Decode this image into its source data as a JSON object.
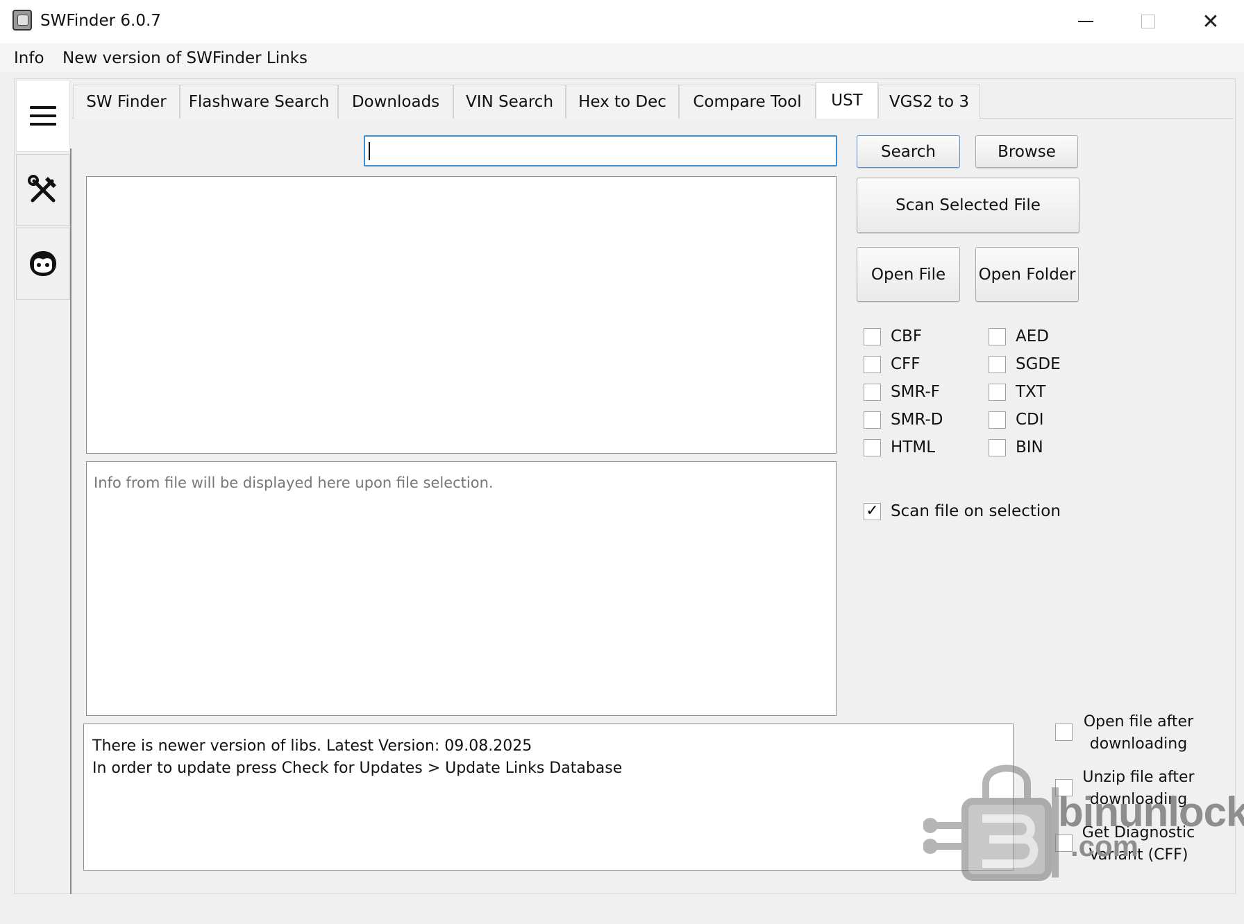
{
  "window": {
    "title": "SWFinder 6.0.7"
  },
  "menu": {
    "items": [
      "Info",
      "New version of SWFinder Links"
    ]
  },
  "sidebar": {
    "buttons": [
      {
        "icon": "hamburger-menu-icon"
      },
      {
        "icon": "tools-icon"
      },
      {
        "icon": "face-icon"
      }
    ]
  },
  "tabs": [
    {
      "label": "SW Finder",
      "active": false
    },
    {
      "label": "Flashware Search",
      "active": false
    },
    {
      "label": "Downloads",
      "active": false
    },
    {
      "label": "VIN Search",
      "active": false
    },
    {
      "label": "Hex to Dec",
      "active": false
    },
    {
      "label": "Compare Tool",
      "active": false
    },
    {
      "label": "UST",
      "active": true
    },
    {
      "label": "VGS2 to 3",
      "active": false
    }
  ],
  "search": {
    "value": ""
  },
  "buttons": {
    "search": "Search",
    "browse": "Browse",
    "scan_selected": "Scan Selected File",
    "open_file": "Open File",
    "open_folder": "Open Folder"
  },
  "filters": {
    "col1": [
      {
        "label": "CBF",
        "checked": false
      },
      {
        "label": "CFF",
        "checked": false
      },
      {
        "label": "SMR-F",
        "checked": false
      },
      {
        "label": "SMR-D",
        "checked": false
      },
      {
        "label": "HTML",
        "checked": false
      }
    ],
    "col2": [
      {
        "label": "AED",
        "checked": false
      },
      {
        "label": "SGDE",
        "checked": false
      },
      {
        "label": "TXT",
        "checked": false
      },
      {
        "label": "CDI",
        "checked": false
      },
      {
        "label": "BIN",
        "checked": false
      }
    ]
  },
  "scan_on_selection": {
    "label": "Scan file on selection",
    "checked": true
  },
  "info_pane": {
    "placeholder": "Info from file will be displayed here upon file selection."
  },
  "log": {
    "line1": "There is newer version of libs. Latest Version: 09.08.2025",
    "line2": "In order to update press Check for Updates > Update Links Database"
  },
  "options": {
    "open_after_download": {
      "line1": "Open file after",
      "line2": "downloading",
      "checked": false
    },
    "unzip_after_download": {
      "line1": "Unzip file after",
      "line2": "downloading",
      "checked": false
    },
    "get_diag_variant": {
      "line1": "Get Diagnostic",
      "line2": "Variant (CFF)",
      "checked": false
    }
  },
  "watermark": {
    "text": "binunlock",
    "sub": ".com"
  }
}
